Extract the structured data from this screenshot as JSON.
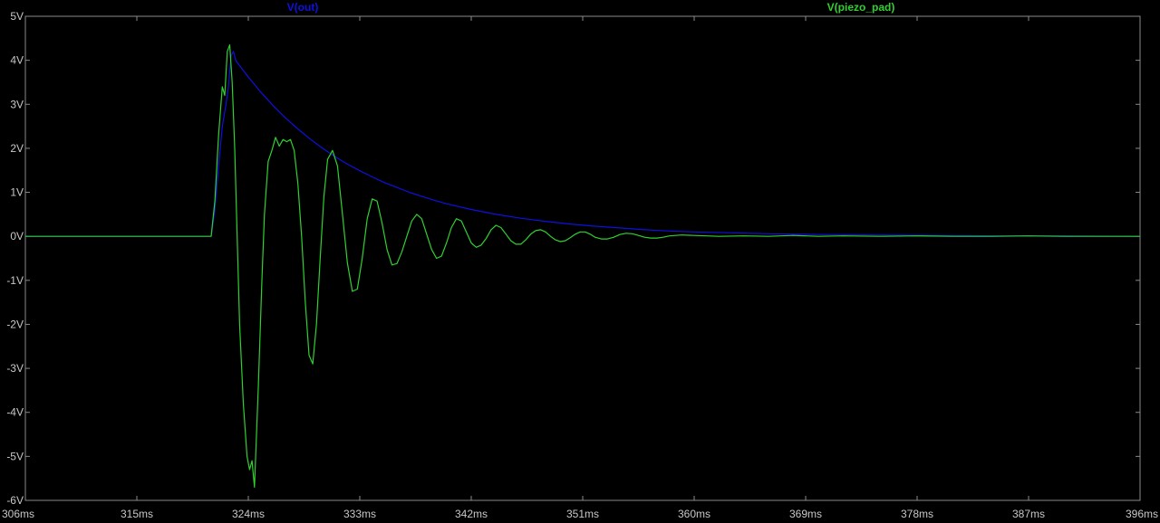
{
  "chart_data": {
    "type": "line",
    "title": "",
    "xlabel": "",
    "ylabel": "",
    "xlim": [
      306,
      396
    ],
    "ylim": [
      -6,
      5
    ],
    "grid": false,
    "legend_placement": "top",
    "colors": {
      "background": "#000000",
      "axes": "#8a8a8a",
      "tick_text": "#c8c8c8"
    },
    "x_ticks": [
      {
        "value": 306,
        "label": "306ms"
      },
      {
        "value": 315,
        "label": "315ms"
      },
      {
        "value": 324,
        "label": "324ms"
      },
      {
        "value": 333,
        "label": "333ms"
      },
      {
        "value": 342,
        "label": "342ms"
      },
      {
        "value": 351,
        "label": "351ms"
      },
      {
        "value": 360,
        "label": "360ms"
      },
      {
        "value": 369,
        "label": "369ms"
      },
      {
        "value": 378,
        "label": "378ms"
      },
      {
        "value": 387,
        "label": "387ms"
      },
      {
        "value": 396,
        "label": "396ms"
      }
    ],
    "y_ticks": [
      {
        "value": 5,
        "label": "5V"
      },
      {
        "value": 4,
        "label": "4V"
      },
      {
        "value": 3,
        "label": "3V"
      },
      {
        "value": 2,
        "label": "2V"
      },
      {
        "value": 1,
        "label": "1V"
      },
      {
        "value": 0,
        "label": "0V"
      },
      {
        "value": -1,
        "label": "-1V"
      },
      {
        "value": -2,
        "label": "-2V"
      },
      {
        "value": -3,
        "label": "-3V"
      },
      {
        "value": -4,
        "label": "-4V"
      },
      {
        "value": -5,
        "label": "-5V"
      },
      {
        "value": -6,
        "label": "-6V"
      }
    ],
    "series": [
      {
        "name": "V(out)",
        "color": "#1010e0",
        "x": [
          306,
          321.0,
          321.3,
          321.6,
          321.9,
          322.2,
          322.4,
          322.6,
          322.8,
          323.0,
          324,
          325,
          326,
          327,
          328,
          329,
          330,
          331,
          332,
          333,
          334,
          335,
          336,
          337,
          338,
          339,
          340,
          342,
          344,
          346,
          348,
          350,
          352,
          354,
          356,
          358,
          360,
          363,
          366,
          370,
          375,
          380,
          385,
          390,
          396
        ],
        "y": [
          0,
          0,
          0.6,
          1.6,
          2.5,
          3.0,
          3.4,
          4.1,
          4.2,
          3.99,
          3.62,
          3.28,
          2.97,
          2.69,
          2.44,
          2.21,
          2.0,
          1.81,
          1.64,
          1.49,
          1.35,
          1.22,
          1.11,
          1.0,
          0.91,
          0.82,
          0.74,
          0.61,
          0.5,
          0.41,
          0.34,
          0.28,
          0.23,
          0.19,
          0.15,
          0.12,
          0.1,
          0.08,
          0.06,
          0.04,
          0.03,
          0.02,
          0.01,
          0.01,
          0.0
        ]
      },
      {
        "name": "V(piezo_pad)",
        "color": "#30d030",
        "x": [
          306,
          321.0,
          321.3,
          321.6,
          321.9,
          322.1,
          322.3,
          322.5,
          322.7,
          322.9,
          323.1,
          323.3,
          323.6,
          323.9,
          324.1,
          324.3,
          324.5,
          324.8,
          325.1,
          325.3,
          325.6,
          325.9,
          326.2,
          326.5,
          326.8,
          327.1,
          327.4,
          327.7,
          328.0,
          328.3,
          328.6,
          328.9,
          329.2,
          329.5,
          329.8,
          330.1,
          330.4,
          330.8,
          331.2,
          331.6,
          332.0,
          332.4,
          332.8,
          333.2,
          333.6,
          334.0,
          334.4,
          334.8,
          335.2,
          335.6,
          336.0,
          336.4,
          336.8,
          337.2,
          337.6,
          338.0,
          338.4,
          338.8,
          339.2,
          339.6,
          340.0,
          340.4,
          340.8,
          341.2,
          341.6,
          342.0,
          342.4,
          342.8,
          343.2,
          343.6,
          344.0,
          344.4,
          344.8,
          345.2,
          345.6,
          346.0,
          346.4,
          346.8,
          347.2,
          347.6,
          348.0,
          348.4,
          348.8,
          349.2,
          349.6,
          350.0,
          350.4,
          350.8,
          351.2,
          351.6,
          352.0,
          352.5,
          353.0,
          353.5,
          354.0,
          354.5,
          355.0,
          355.5,
          356.0,
          356.5,
          357.0,
          357.5,
          358.0,
          359.0,
          360.0,
          362,
          364,
          366,
          368,
          370,
          372,
          375,
          378,
          381,
          384,
          387,
          390,
          393,
          396
        ],
        "y": [
          0,
          0,
          0.8,
          2.3,
          3.4,
          3.2,
          4.2,
          4.35,
          3.5,
          2.0,
          0.0,
          -2.0,
          -3.8,
          -5.0,
          -5.3,
          -5.1,
          -5.7,
          -3.5,
          -1.0,
          0.5,
          1.7,
          1.95,
          2.25,
          2.05,
          2.2,
          2.15,
          2.2,
          1.95,
          1.2,
          0.0,
          -1.5,
          -2.7,
          -2.9,
          -2.0,
          -0.5,
          0.9,
          1.75,
          1.95,
          1.6,
          0.5,
          -0.6,
          -1.25,
          -1.2,
          -0.5,
          0.4,
          0.85,
          0.8,
          0.3,
          -0.3,
          -0.65,
          -0.62,
          -0.35,
          0.0,
          0.35,
          0.5,
          0.4,
          0.05,
          -0.3,
          -0.5,
          -0.45,
          -0.15,
          0.2,
          0.4,
          0.35,
          0.1,
          -0.15,
          -0.25,
          -0.2,
          -0.05,
          0.15,
          0.25,
          0.2,
          0.05,
          -0.1,
          -0.18,
          -0.18,
          -0.08,
          0.05,
          0.13,
          0.15,
          0.1,
          0.0,
          -0.08,
          -0.12,
          -0.1,
          -0.03,
          0.05,
          0.1,
          0.1,
          0.05,
          -0.02,
          -0.06,
          -0.06,
          -0.02,
          0.04,
          0.07,
          0.06,
          0.02,
          -0.02,
          -0.04,
          -0.04,
          -0.02,
          0.01,
          0.03,
          0.02,
          0.0,
          0.01,
          0.0,
          0.02,
          0.0,
          0.01,
          0.0,
          0.01,
          0.0,
          0.0,
          0.01,
          0.0,
          0.0,
          0.0
        ]
      }
    ]
  }
}
